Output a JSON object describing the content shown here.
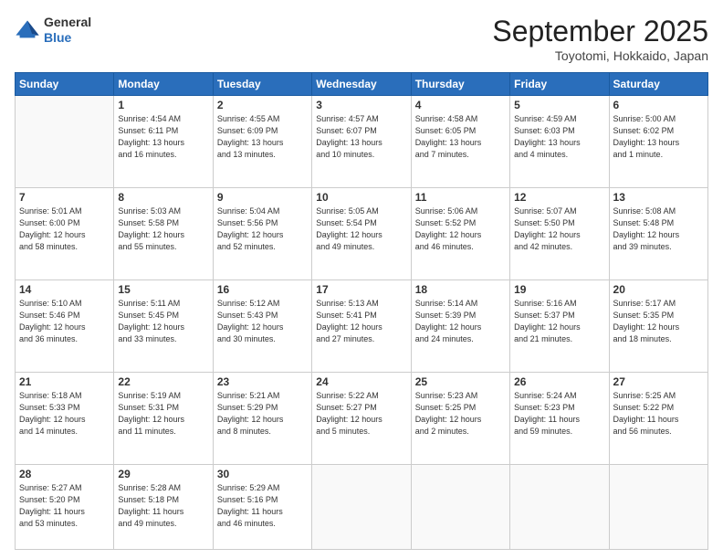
{
  "header": {
    "logo": {
      "general": "General",
      "blue": "Blue"
    },
    "title": "September 2025",
    "location": "Toyotomi, Hokkaido, Japan"
  },
  "weekdays": [
    "Sunday",
    "Monday",
    "Tuesday",
    "Wednesday",
    "Thursday",
    "Friday",
    "Saturday"
  ],
  "weeks": [
    [
      {
        "day": "",
        "info": ""
      },
      {
        "day": "1",
        "info": "Sunrise: 4:54 AM\nSunset: 6:11 PM\nDaylight: 13 hours\nand 16 minutes."
      },
      {
        "day": "2",
        "info": "Sunrise: 4:55 AM\nSunset: 6:09 PM\nDaylight: 13 hours\nand 13 minutes."
      },
      {
        "day": "3",
        "info": "Sunrise: 4:57 AM\nSunset: 6:07 PM\nDaylight: 13 hours\nand 10 minutes."
      },
      {
        "day": "4",
        "info": "Sunrise: 4:58 AM\nSunset: 6:05 PM\nDaylight: 13 hours\nand 7 minutes."
      },
      {
        "day": "5",
        "info": "Sunrise: 4:59 AM\nSunset: 6:03 PM\nDaylight: 13 hours\nand 4 minutes."
      },
      {
        "day": "6",
        "info": "Sunrise: 5:00 AM\nSunset: 6:02 PM\nDaylight: 13 hours\nand 1 minute."
      }
    ],
    [
      {
        "day": "7",
        "info": "Sunrise: 5:01 AM\nSunset: 6:00 PM\nDaylight: 12 hours\nand 58 minutes."
      },
      {
        "day": "8",
        "info": "Sunrise: 5:03 AM\nSunset: 5:58 PM\nDaylight: 12 hours\nand 55 minutes."
      },
      {
        "day": "9",
        "info": "Sunrise: 5:04 AM\nSunset: 5:56 PM\nDaylight: 12 hours\nand 52 minutes."
      },
      {
        "day": "10",
        "info": "Sunrise: 5:05 AM\nSunset: 5:54 PM\nDaylight: 12 hours\nand 49 minutes."
      },
      {
        "day": "11",
        "info": "Sunrise: 5:06 AM\nSunset: 5:52 PM\nDaylight: 12 hours\nand 46 minutes."
      },
      {
        "day": "12",
        "info": "Sunrise: 5:07 AM\nSunset: 5:50 PM\nDaylight: 12 hours\nand 42 minutes."
      },
      {
        "day": "13",
        "info": "Sunrise: 5:08 AM\nSunset: 5:48 PM\nDaylight: 12 hours\nand 39 minutes."
      }
    ],
    [
      {
        "day": "14",
        "info": "Sunrise: 5:10 AM\nSunset: 5:46 PM\nDaylight: 12 hours\nand 36 minutes."
      },
      {
        "day": "15",
        "info": "Sunrise: 5:11 AM\nSunset: 5:45 PM\nDaylight: 12 hours\nand 33 minutes."
      },
      {
        "day": "16",
        "info": "Sunrise: 5:12 AM\nSunset: 5:43 PM\nDaylight: 12 hours\nand 30 minutes."
      },
      {
        "day": "17",
        "info": "Sunrise: 5:13 AM\nSunset: 5:41 PM\nDaylight: 12 hours\nand 27 minutes."
      },
      {
        "day": "18",
        "info": "Sunrise: 5:14 AM\nSunset: 5:39 PM\nDaylight: 12 hours\nand 24 minutes."
      },
      {
        "day": "19",
        "info": "Sunrise: 5:16 AM\nSunset: 5:37 PM\nDaylight: 12 hours\nand 21 minutes."
      },
      {
        "day": "20",
        "info": "Sunrise: 5:17 AM\nSunset: 5:35 PM\nDaylight: 12 hours\nand 18 minutes."
      }
    ],
    [
      {
        "day": "21",
        "info": "Sunrise: 5:18 AM\nSunset: 5:33 PM\nDaylight: 12 hours\nand 14 minutes."
      },
      {
        "day": "22",
        "info": "Sunrise: 5:19 AM\nSunset: 5:31 PM\nDaylight: 12 hours\nand 11 minutes."
      },
      {
        "day": "23",
        "info": "Sunrise: 5:21 AM\nSunset: 5:29 PM\nDaylight: 12 hours\nand 8 minutes."
      },
      {
        "day": "24",
        "info": "Sunrise: 5:22 AM\nSunset: 5:27 PM\nDaylight: 12 hours\nand 5 minutes."
      },
      {
        "day": "25",
        "info": "Sunrise: 5:23 AM\nSunset: 5:25 PM\nDaylight: 12 hours\nand 2 minutes."
      },
      {
        "day": "26",
        "info": "Sunrise: 5:24 AM\nSunset: 5:23 PM\nDaylight: 11 hours\nand 59 minutes."
      },
      {
        "day": "27",
        "info": "Sunrise: 5:25 AM\nSunset: 5:22 PM\nDaylight: 11 hours\nand 56 minutes."
      }
    ],
    [
      {
        "day": "28",
        "info": "Sunrise: 5:27 AM\nSunset: 5:20 PM\nDaylight: 11 hours\nand 53 minutes."
      },
      {
        "day": "29",
        "info": "Sunrise: 5:28 AM\nSunset: 5:18 PM\nDaylight: 11 hours\nand 49 minutes."
      },
      {
        "day": "30",
        "info": "Sunrise: 5:29 AM\nSunset: 5:16 PM\nDaylight: 11 hours\nand 46 minutes."
      },
      {
        "day": "",
        "info": ""
      },
      {
        "day": "",
        "info": ""
      },
      {
        "day": "",
        "info": ""
      },
      {
        "day": "",
        "info": ""
      }
    ]
  ]
}
